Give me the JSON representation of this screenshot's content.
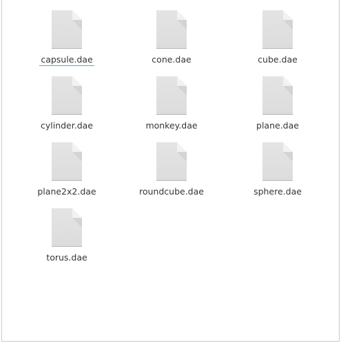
{
  "files": [
    {
      "name": "capsule.dae",
      "icon": "document-icon",
      "current": true
    },
    {
      "name": "cone.dae",
      "icon": "document-icon",
      "current": false
    },
    {
      "name": "cube.dae",
      "icon": "document-icon",
      "current": false
    },
    {
      "name": "cylinder.dae",
      "icon": "document-icon",
      "current": false
    },
    {
      "name": "monkey.dae",
      "icon": "document-icon",
      "current": false
    },
    {
      "name": "plane.dae",
      "icon": "document-icon",
      "current": false
    },
    {
      "name": "plane2x2.dae",
      "icon": "document-icon",
      "current": false
    },
    {
      "name": "roundcube.dae",
      "icon": "document-icon",
      "current": false
    },
    {
      "name": "sphere.dae",
      "icon": "document-icon",
      "current": false
    },
    {
      "name": "torus.dae",
      "icon": "document-icon",
      "current": false
    }
  ],
  "colors": {
    "focus_underline": "#3daee9",
    "label_text": "#31363b",
    "icon_body": "#dcdcdc",
    "icon_fold": "#f2f2f2"
  }
}
